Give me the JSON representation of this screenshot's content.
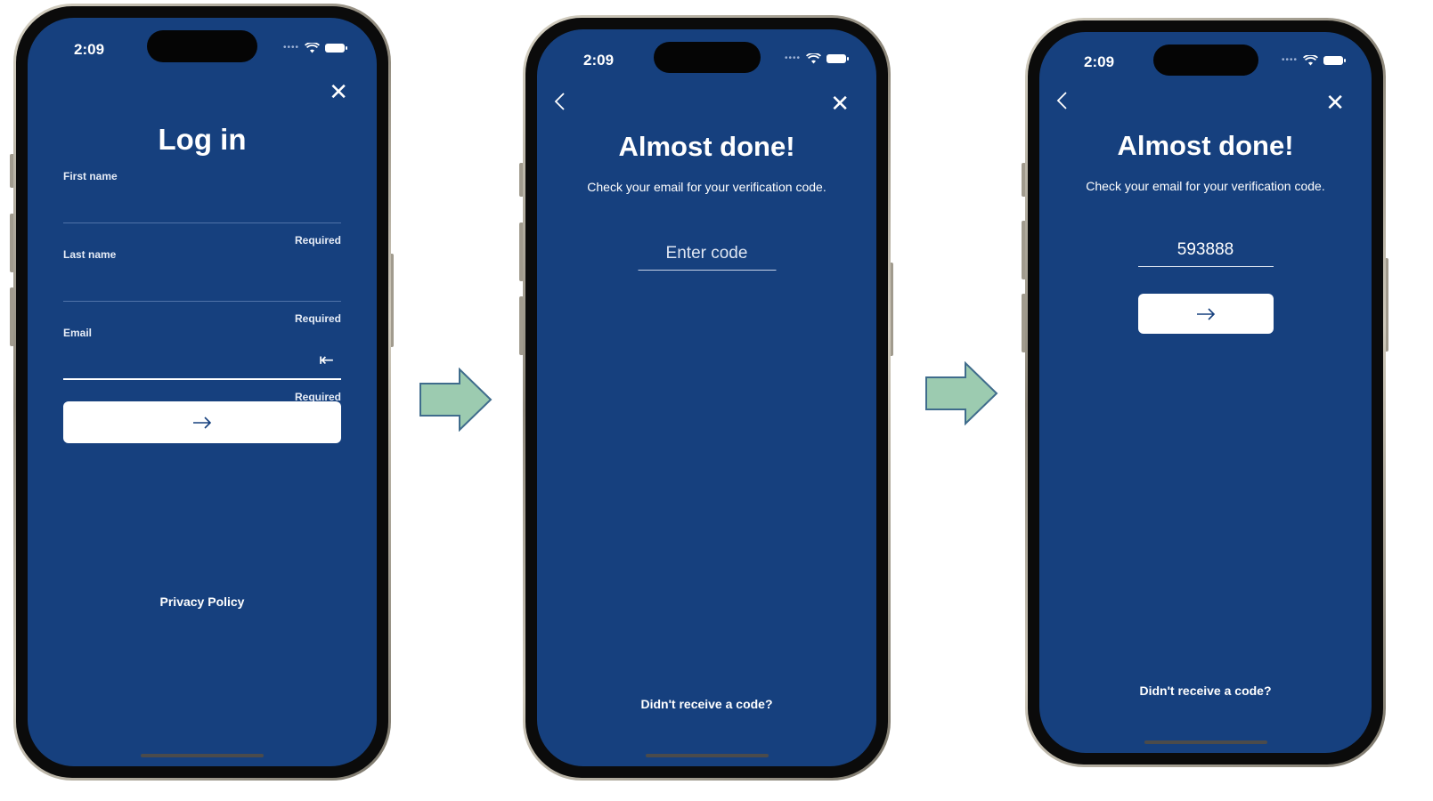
{
  "status": {
    "time": "2:09"
  },
  "screen1": {
    "title": "Log in",
    "fields": [
      {
        "label": "First name",
        "hint": "Required",
        "value": ""
      },
      {
        "label": "Last name",
        "hint": "Required",
        "value": ""
      },
      {
        "label": "Email",
        "hint": "Required",
        "value": ""
      }
    ],
    "submit_icon": "arrow-right-icon",
    "footer_link": "Privacy Policy"
  },
  "screen2": {
    "title": "Almost done!",
    "subtitle": "Check your email for your verification code.",
    "code_placeholder": "Enter code",
    "code_value": "",
    "footer_link": "Didn't receive a code?"
  },
  "screen3": {
    "title": "Almost done!",
    "subtitle": "Check your email for your verification code.",
    "code_value": "593888",
    "submit_icon": "arrow-right-icon",
    "footer_link": "Didn't receive a code?"
  },
  "colors": {
    "screen_bg": "#16407e",
    "flow_arrow_fill": "#9ccbb0",
    "flow_arrow_stroke": "#3f6c8c"
  }
}
